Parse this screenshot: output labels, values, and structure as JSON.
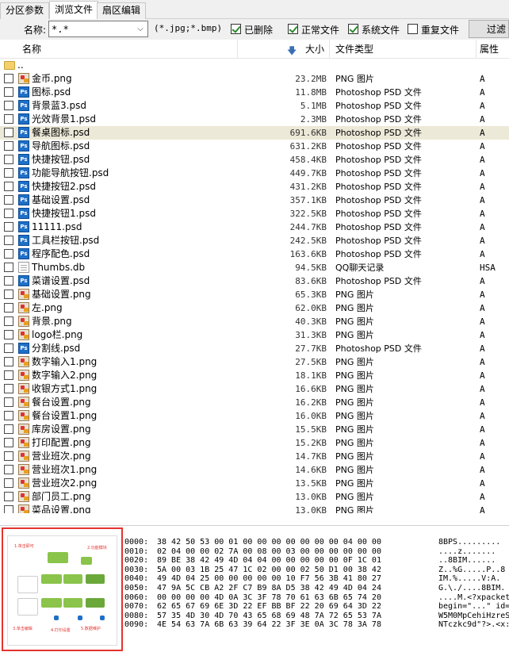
{
  "tabs": [
    {
      "label": "分区参数",
      "active": false
    },
    {
      "label": "浏览文件",
      "active": true
    },
    {
      "label": "扇区编辑",
      "active": false
    }
  ],
  "filter": {
    "name_label": "名称:",
    "name_value": "*.*",
    "ext_hint": "(*.jpg;*.bmp)",
    "checks": [
      {
        "label": "已删除",
        "checked": true
      },
      {
        "label": "正常文件",
        "checked": true
      },
      {
        "label": "系统文件",
        "checked": true
      },
      {
        "label": "重复文件",
        "checked": false
      }
    ],
    "button_label": "过滤"
  },
  "columns": {
    "name": "名称",
    "size": "大小",
    "type": "文件类型",
    "attr": "属性"
  },
  "parent_row": {
    "name": ".."
  },
  "files": [
    {
      "name": "金币.png",
      "size": "23.2MB",
      "type": "PNG 图片",
      "attr": "A",
      "icon": "png"
    },
    {
      "name": "图标.psd",
      "size": "11.8MB",
      "type": "Photoshop PSD 文件",
      "attr": "A",
      "icon": "psd"
    },
    {
      "name": "背景蓝3.psd",
      "size": "5.1MB",
      "type": "Photoshop PSD 文件",
      "attr": "A",
      "icon": "psd"
    },
    {
      "name": "光效背景1.psd",
      "size": "2.3MB",
      "type": "Photoshop PSD 文件",
      "attr": "A",
      "icon": "psd"
    },
    {
      "name": "餐桌图标.psd",
      "size": "691.6KB",
      "type": "Photoshop PSD 文件",
      "attr": "A",
      "icon": "psd",
      "selected": true
    },
    {
      "name": "导航图标.psd",
      "size": "631.2KB",
      "type": "Photoshop PSD 文件",
      "attr": "A",
      "icon": "psd"
    },
    {
      "name": "快捷按钮.psd",
      "size": "458.4KB",
      "type": "Photoshop PSD 文件",
      "attr": "A",
      "icon": "psd"
    },
    {
      "name": "功能导航按钮.psd",
      "size": "449.7KB",
      "type": "Photoshop PSD 文件",
      "attr": "A",
      "icon": "psd"
    },
    {
      "name": "快捷按钮2.psd",
      "size": "431.2KB",
      "type": "Photoshop PSD 文件",
      "attr": "A",
      "icon": "psd"
    },
    {
      "name": "基础设置.psd",
      "size": "357.1KB",
      "type": "Photoshop PSD 文件",
      "attr": "A",
      "icon": "psd"
    },
    {
      "name": "快捷按钮1.psd",
      "size": "322.5KB",
      "type": "Photoshop PSD 文件",
      "attr": "A",
      "icon": "psd"
    },
    {
      "name": "11111.psd",
      "size": "244.7KB",
      "type": "Photoshop PSD 文件",
      "attr": "A",
      "icon": "psd"
    },
    {
      "name": "工具栏按钮.psd",
      "size": "242.5KB",
      "type": "Photoshop PSD 文件",
      "attr": "A",
      "icon": "psd"
    },
    {
      "name": "程序配色.psd",
      "size": "163.6KB",
      "type": "Photoshop PSD 文件",
      "attr": "A",
      "icon": "psd"
    },
    {
      "name": "Thumbs.db",
      "size": "94.5KB",
      "type": "QQ聊天记录",
      "attr": "HSA",
      "icon": "db"
    },
    {
      "name": "菜谱设置.psd",
      "size": "83.6KB",
      "type": "Photoshop PSD 文件",
      "attr": "A",
      "icon": "psd"
    },
    {
      "name": "基础设置.png",
      "size": "65.3KB",
      "type": "PNG 图片",
      "attr": "A",
      "icon": "png"
    },
    {
      "name": "左.png",
      "size": "62.0KB",
      "type": "PNG 图片",
      "attr": "A",
      "icon": "png"
    },
    {
      "name": "背景.png",
      "size": "40.3KB",
      "type": "PNG 图片",
      "attr": "A",
      "icon": "png"
    },
    {
      "name": "logo栏.png",
      "size": "31.3KB",
      "type": "PNG 图片",
      "attr": "A",
      "icon": "png"
    },
    {
      "name": "分割线.psd",
      "size": "27.7KB",
      "type": "Photoshop PSD 文件",
      "attr": "A",
      "icon": "psd"
    },
    {
      "name": "数字输入1.png",
      "size": "27.5KB",
      "type": "PNG 图片",
      "attr": "A",
      "icon": "png"
    },
    {
      "name": "数字输入2.png",
      "size": "18.1KB",
      "type": "PNG 图片",
      "attr": "A",
      "icon": "png"
    },
    {
      "name": "收银方式1.png",
      "size": "16.6KB",
      "type": "PNG 图片",
      "attr": "A",
      "icon": "png"
    },
    {
      "name": "餐台设置.png",
      "size": "16.2KB",
      "type": "PNG 图片",
      "attr": "A",
      "icon": "png"
    },
    {
      "name": "餐台设置1.png",
      "size": "16.0KB",
      "type": "PNG 图片",
      "attr": "A",
      "icon": "png"
    },
    {
      "name": "库房设置.png",
      "size": "15.5KB",
      "type": "PNG 图片",
      "attr": "A",
      "icon": "png"
    },
    {
      "name": "打印配置.png",
      "size": "15.2KB",
      "type": "PNG 图片",
      "attr": "A",
      "icon": "png"
    },
    {
      "name": "营业班次.png",
      "size": "14.7KB",
      "type": "PNG 图片",
      "attr": "A",
      "icon": "png"
    },
    {
      "name": "营业班次1.png",
      "size": "14.6KB",
      "type": "PNG 图片",
      "attr": "A",
      "icon": "png"
    },
    {
      "name": "营业班次2.png",
      "size": "13.5KB",
      "type": "PNG 图片",
      "attr": "A",
      "icon": "png"
    },
    {
      "name": "部门员工.png",
      "size": "13.0KB",
      "type": "PNG 图片",
      "attr": "A",
      "icon": "png"
    },
    {
      "name": "菜品设置.png",
      "size": "13.0KB",
      "type": "PNG 图片",
      "attr": "A",
      "icon": "png"
    }
  ],
  "hex": {
    "offsets": [
      "0000:",
      "0010:",
      "0020:",
      "0030:",
      "0040:",
      "0050:",
      "0060:",
      "0070:",
      "0080:",
      "0090:"
    ],
    "bytes": [
      "38 42 50 53 00 01 00 00 00 00 00 00 00 04 00 00",
      "02 04 00 00 02 7A 00 08 00 03 00 00 00 00 00 00",
      "89 BE 38 42 49 4D 04 04 00 00 00 00 00 0F 1C 01",
      "5A 00 03 1B 25 47 1C 02 00 00 02 50 D1 00 38 42",
      "49 4D 04 25 00 00 00 00 00 10 F7 56 3B 41 80 27",
      "47 9A 5C CB A2 2F C7 B9 8A D5 38 42 49 4D 04 24",
      "00 00 00 00 4D 0A 3C 3F 78 70 61 63 6B 65 74 20",
      "62 65 67 69 6E 3D 22 EF BB BF 22 20 69 64 3D 22",
      "57 35 4D 30 4D 70 43 65 68 69 48 7A 72 65 53 7A",
      "4E 54 63 7A 6B 63 39 64 22 3F 3E 0A 3C 78 3A 78"
    ],
    "ascii": [
      "8BPS.........",
      "....z.......",
      "..8BIM......",
      "Z..%G.....P..8",
      "IM.%.....V:A.",
      "G.\\./....8BIM.",
      "....M.<?xpacket",
      "begin=\"...\" id=",
      "W5M0MpCehiHzreS",
      "NTczkc9d\"?>.<x:"
    ]
  },
  "preview": {
    "notes": [
      "1.单击即可",
      "2.功能模块",
      "3.单击编辑",
      "4.打印设置",
      "5.数据维护"
    ]
  }
}
